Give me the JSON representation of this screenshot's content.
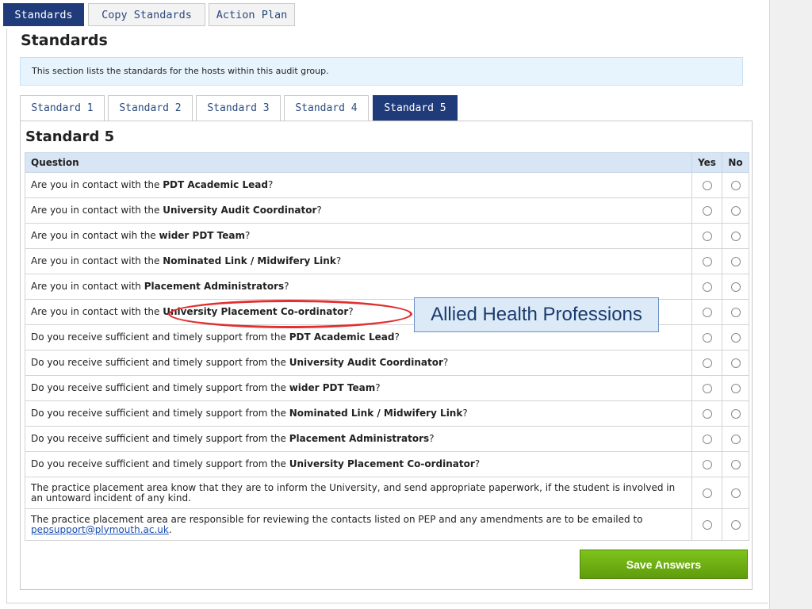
{
  "top_tabs": [
    {
      "label": "Standards",
      "active": true
    },
    {
      "label": "Copy Standards",
      "active": false
    },
    {
      "label": "Action Plan",
      "active": false
    }
  ],
  "section_title": "Standards",
  "info_text": "This section lists the standards for the hosts within this audit group.",
  "standard_tabs": [
    {
      "label": "Standard 1",
      "active": false
    },
    {
      "label": "Standard 2",
      "active": false
    },
    {
      "label": "Standard 3",
      "active": false
    },
    {
      "label": "Standard 4",
      "active": false
    },
    {
      "label": "Standard 5",
      "active": true
    }
  ],
  "panel_title": "Standard 5",
  "table": {
    "headers": {
      "question": "Question",
      "yes": "Yes",
      "no": "No"
    },
    "rows": [
      {
        "pre": "Are you in contact with the ",
        "bold": "PDT Academic Lead",
        "post": "?"
      },
      {
        "pre": "Are you in contact with the ",
        "bold": "University Audit Coordinator",
        "post": "?"
      },
      {
        "pre": "Are you in contact wih the ",
        "bold": "wider PDT Team",
        "post": "?"
      },
      {
        "pre": "Are you in contact with the ",
        "bold": "Nominated Link / Midwifery Link",
        "post": "?"
      },
      {
        "pre": "Are you in contact with ",
        "bold": "Placement Administrators",
        "post": "?"
      },
      {
        "pre": "Are you in contact with the ",
        "bold": "University Placement Co-ordinator",
        "post": "?"
      },
      {
        "pre": "Do you receive sufficient and timely support from the ",
        "bold": "PDT Academic Lead",
        "post": "?"
      },
      {
        "pre": "Do you receive sufficient and timely support from the ",
        "bold": "University Audit Coordinator",
        "post": "?"
      },
      {
        "pre": "Do you receive sufficient and timely support from the ",
        "bold": "wider PDT Team",
        "post": "?"
      },
      {
        "pre": "Do you receive sufficient and timely support from the ",
        "bold": "Nominated Link / Midwifery Link",
        "post": "?"
      },
      {
        "pre": "Do you receive sufficient and timely support from the ",
        "bold": "Placement Administrators",
        "post": "?"
      },
      {
        "pre": "Do you receive sufficient and timely support from the ",
        "bold": "University Placement Co-ordinator",
        "post": "?"
      },
      {
        "pre": "The practice placement area know that they are to inform the University, and send appropriate paperwork, if the student is involved in an untoward incident of any kind.",
        "bold": "",
        "post": ""
      },
      {
        "pre": "The practice placement area are responsible for reviewing the contacts listed on PEP and any amendments are to be emailed to ",
        "bold": "",
        "post": "",
        "link": "pepsupport@plymouth.ac.uk",
        "after_link": "."
      }
    ]
  },
  "save_button": "Save Answers",
  "annotation": {
    "callout_text": "Allied Health Professions",
    "ellipse_color": "#e03030"
  },
  "colors": {
    "active_tab": "#1f3b7a",
    "header_bg": "#d7e5f5",
    "info_bg": "#e8f4fd",
    "button": "#6aaa12"
  }
}
